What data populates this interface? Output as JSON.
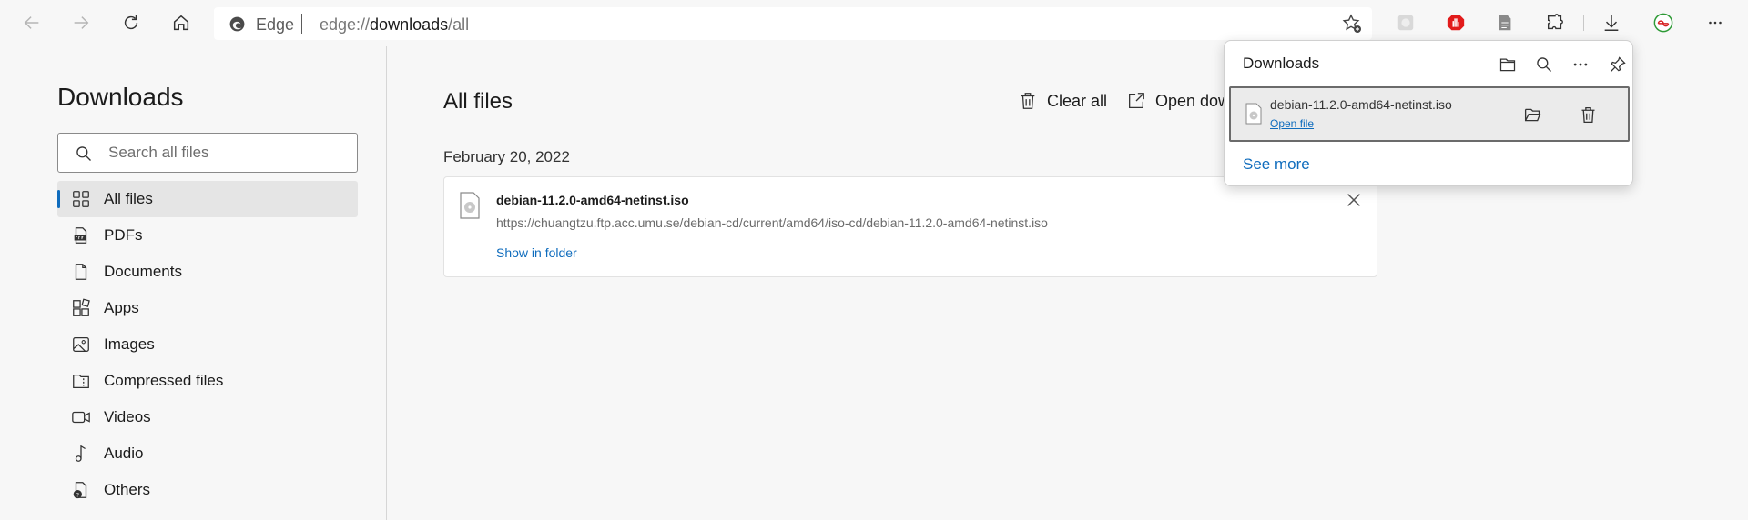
{
  "browser": {
    "address_site": "Edge",
    "address_url_prefix": "edge://",
    "address_url_main": "downloads",
    "address_url_suffix": "/all"
  },
  "sidebar": {
    "title": "Downloads",
    "search_placeholder": "Search all files",
    "items": [
      {
        "label": "All files",
        "icon": "grid-icon",
        "active": true
      },
      {
        "label": "PDFs",
        "icon": "pdf-icon"
      },
      {
        "label": "Documents",
        "icon": "document-icon"
      },
      {
        "label": "Apps",
        "icon": "apps-icon"
      },
      {
        "label": "Images",
        "icon": "image-icon"
      },
      {
        "label": "Compressed files",
        "icon": "archive-icon"
      },
      {
        "label": "Videos",
        "icon": "video-icon"
      },
      {
        "label": "Audio",
        "icon": "audio-icon"
      },
      {
        "label": "Others",
        "icon": "other-file-icon"
      }
    ]
  },
  "main": {
    "title": "All files",
    "clear_all": "Clear all",
    "open_downloads": "Open dow",
    "groups": [
      {
        "date": "February 20, 2022",
        "items": [
          {
            "name": "debian-11.2.0-amd64-netinst.iso",
            "url": "https://chuangtzu.ftp.acc.umu.se/debian-cd/current/amd64/iso-cd/debian-11.2.0-amd64-netinst.iso",
            "action": "Show in folder"
          }
        ]
      }
    ]
  },
  "flyout": {
    "title": "Downloads",
    "item_name": "debian-11.2.0-amd64-netinst.iso",
    "item_action": "Open file",
    "see_more": "See more"
  },
  "colors": {
    "accent": "#0f6cbd",
    "background": "#f7f7f7"
  }
}
